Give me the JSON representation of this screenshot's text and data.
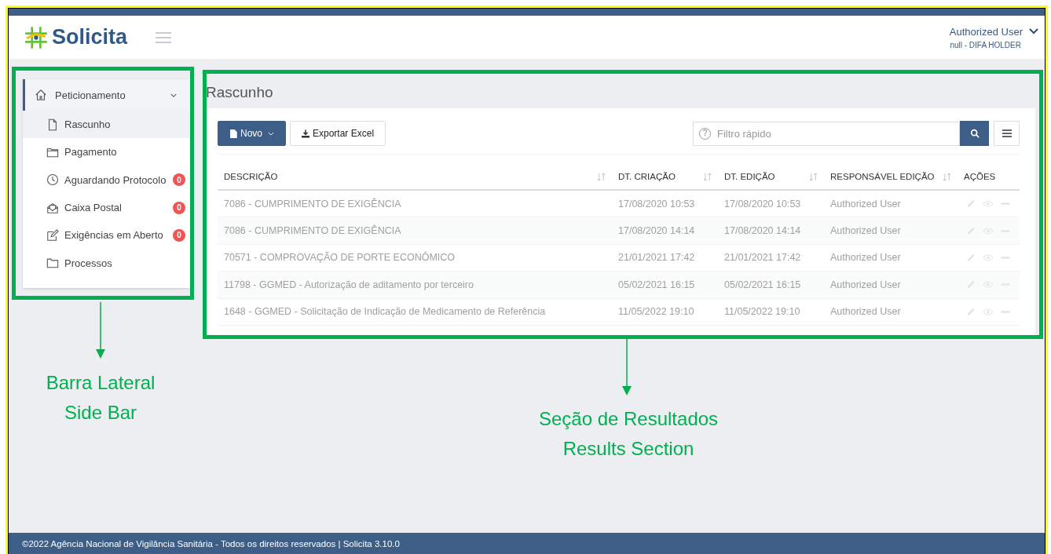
{
  "header": {
    "logo": "Solicita",
    "user": {
      "name": "Authorized User",
      "role": "null - DIFA HOLDER"
    }
  },
  "sidebar": {
    "items": [
      {
        "label": "Peticionamento",
        "expanded": true,
        "children": [
          {
            "label": "Rascunho",
            "selected": true
          },
          {
            "label": "Pagamento",
            "selected": false
          },
          {
            "label": "Aguardando Protocolo",
            "selected": false,
            "badge": "0"
          },
          {
            "label": "Caixa Postal",
            "selected": false,
            "badge": "0"
          },
          {
            "label": "Exigências em Aberto",
            "selected": false,
            "badge": "0"
          },
          {
            "label": "Processos",
            "selected": false
          }
        ]
      }
    ]
  },
  "main": {
    "title": "Rascunho",
    "new_button": "Novo",
    "export_button": "Exportar Excel",
    "search": {
      "placeholder": "Filtro rápido",
      "hint_icon": "?"
    },
    "table": {
      "columns": [
        "DESCRIÇÃO",
        "DT. CRIAÇÃO",
        "DT. EDIÇÃO",
        "RESPONSÁVEL EDIÇÃO",
        "AÇÕES"
      ],
      "rows": [
        [
          "7086 - CUMPRIMENTO DE EXIGÊNCIA",
          "17/08/2020 10:53",
          "17/08/2020 10:53",
          "Authorized User"
        ],
        [
          "7086 - CUMPRIMENTO DE EXIGÊNCIA",
          "17/08/2020 14:14",
          "17/08/2020 14:14",
          "Authorized User"
        ],
        [
          "70571 - COMPROVAÇÃO DE PORTE ECONÔMICO",
          "21/01/2021 17:42",
          "21/01/2021 17:42",
          "Authorized User"
        ],
        [
          "11798 - GGMED - Autorização de aditamento por terceiro",
          "05/02/2021 16:15",
          "05/02/2021 16:15",
          "Authorized User"
        ],
        [
          "1648 - GGMED - Solicitação de Indicação de Medicamento de Referência",
          "11/05/2022 19:10",
          "11/05/2022 19:10",
          "Authorized User"
        ]
      ]
    }
  },
  "footer": "©2022 Agência Nacional de Vigilância Sanitária - Todos os direitos reservados | Solicita 3.10.0",
  "annotations": [
    {
      "lines": [
        "Barra Lateral",
        "Side Bar"
      ]
    },
    {
      "lines": [
        "Seção de Resultados",
        "Results Section"
      ]
    }
  ]
}
